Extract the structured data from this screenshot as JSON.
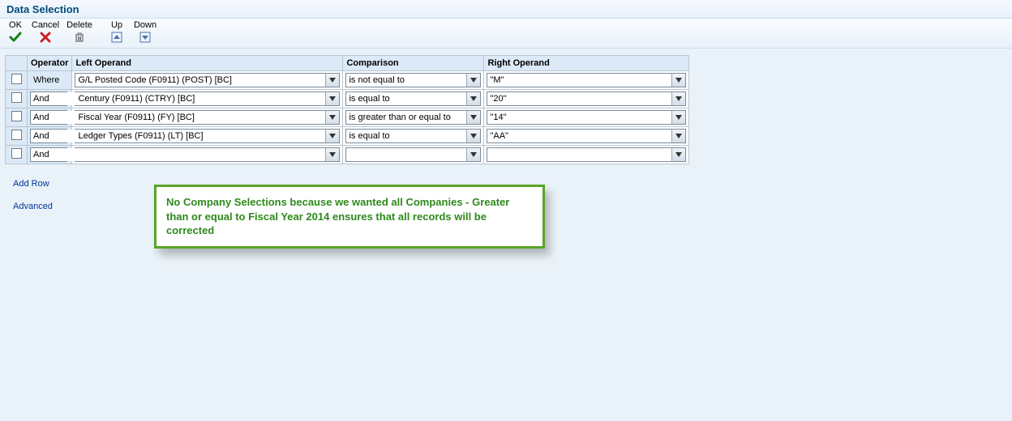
{
  "title": "Data Selection",
  "toolbar": {
    "ok": {
      "label": "OK"
    },
    "cancel": {
      "label": "Cancel"
    },
    "delete": {
      "label": "Delete"
    },
    "up": {
      "label": "Up"
    },
    "down": {
      "label": "Down"
    }
  },
  "columns": {
    "chk": "",
    "operator": "Operator",
    "left": "Left Operand",
    "comparison": "Comparison",
    "right": "Right Operand"
  },
  "rows": [
    {
      "operator_text": "Where",
      "operator_is_dropdown": false,
      "left": "G/L Posted Code (F0911) (POST) [BC]",
      "comparison": "is not equal to",
      "right": "\"M\""
    },
    {
      "operator_text": "And",
      "operator_is_dropdown": true,
      "left": "Century (F0911) (CTRY) [BC]",
      "comparison": "is equal to",
      "right": "\"20\""
    },
    {
      "operator_text": "And",
      "operator_is_dropdown": true,
      "left": "Fiscal Year (F0911) (FY) [BC]",
      "comparison": "is greater than or equal to",
      "right": "\"14\""
    },
    {
      "operator_text": "And",
      "operator_is_dropdown": true,
      "left": "Ledger Types (F0911) (LT) [BC]",
      "comparison": "is equal to",
      "right": "\"AA\""
    },
    {
      "operator_text": "And",
      "operator_is_dropdown": true,
      "left": "",
      "comparison": "",
      "right": ""
    }
  ],
  "links": {
    "add_row": "Add Row",
    "advanced": "Advanced"
  },
  "callout": "No Company Selections because we wanted all Companies  - Greater than or equal to Fiscal Year 2014 ensures that all records will be corrected"
}
